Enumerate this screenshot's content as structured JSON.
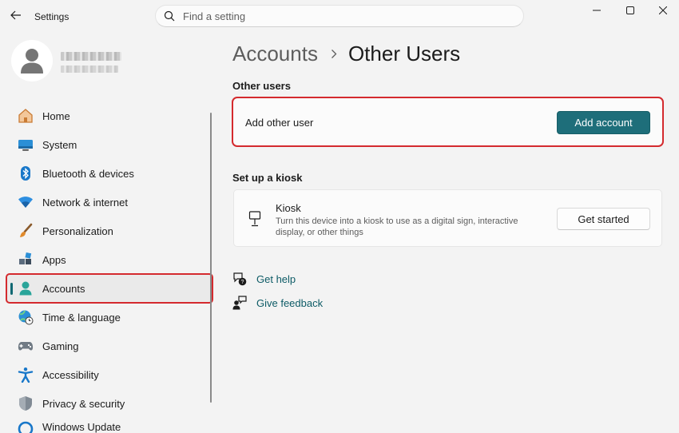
{
  "window": {
    "title": "Settings"
  },
  "search": {
    "placeholder": "Find a setting"
  },
  "sidebar": {
    "items": [
      {
        "label": "Home"
      },
      {
        "label": "System"
      },
      {
        "label": "Bluetooth & devices"
      },
      {
        "label": "Network & internet"
      },
      {
        "label": "Personalization"
      },
      {
        "label": "Apps"
      },
      {
        "label": "Accounts",
        "selected": true
      },
      {
        "label": "Time & language"
      },
      {
        "label": "Gaming"
      },
      {
        "label": "Accessibility"
      },
      {
        "label": "Privacy & security"
      },
      {
        "label": "Windows Update"
      }
    ]
  },
  "breadcrumb": {
    "parent": "Accounts",
    "current": "Other Users"
  },
  "other_users": {
    "section_title": "Other users",
    "row_label": "Add other user",
    "button_label": "Add account"
  },
  "kiosk": {
    "section_title": "Set up a kiosk",
    "title": "Kiosk",
    "description": "Turn this device into a kiosk to use as a digital sign, interactive display, or other things",
    "button_label": "Get started"
  },
  "links": {
    "help": "Get help",
    "feedback": "Give feedback"
  },
  "colors": {
    "accent": "#1e6e7a",
    "highlight_outline": "#d42a2e",
    "background": "#f3f3f3"
  }
}
